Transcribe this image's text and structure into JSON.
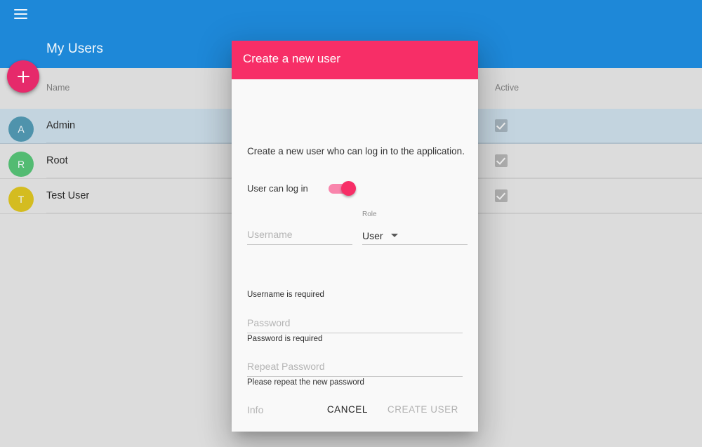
{
  "appbar": {
    "menu_icon": "hamburger-menu-icon",
    "title": "My Users"
  },
  "fab": {
    "icon": "plus-icon",
    "label": "+"
  },
  "table": {
    "columns": [
      "Name",
      "Active"
    ],
    "rows": [
      {
        "initial": "A",
        "name": "Admin",
        "active": true,
        "selected": true,
        "avatar_color": "#4f93ac"
      },
      {
        "initial": "R",
        "name": "Root",
        "active": true,
        "selected": false,
        "avatar_color": "#53bb72"
      },
      {
        "initial": "T",
        "name": "Test User",
        "active": true,
        "selected": false,
        "avatar_color": "#d4bc20"
      }
    ]
  },
  "dialog": {
    "title": "Create a new user",
    "header_color": "#f72e67",
    "description": "Create a new user who can log in to the application.",
    "toggle": {
      "label": "User can log in",
      "checked": true
    },
    "fields": {
      "username": {
        "placeholder": "Username",
        "value": "",
        "hint": "Username is required"
      },
      "role": {
        "label": "Role",
        "value": "User",
        "caret_icon": "chevron-down-icon"
      },
      "password": {
        "placeholder": "Password",
        "value": "",
        "hint": "Password is required"
      },
      "repeat_password": {
        "placeholder": "Repeat Password",
        "value": "",
        "hint": "Please repeat the new password"
      },
      "info": {
        "placeholder": "Info",
        "value": ""
      }
    },
    "actions": {
      "cancel": "CANCEL",
      "create": "CREATE USER",
      "create_disabled": true
    }
  }
}
